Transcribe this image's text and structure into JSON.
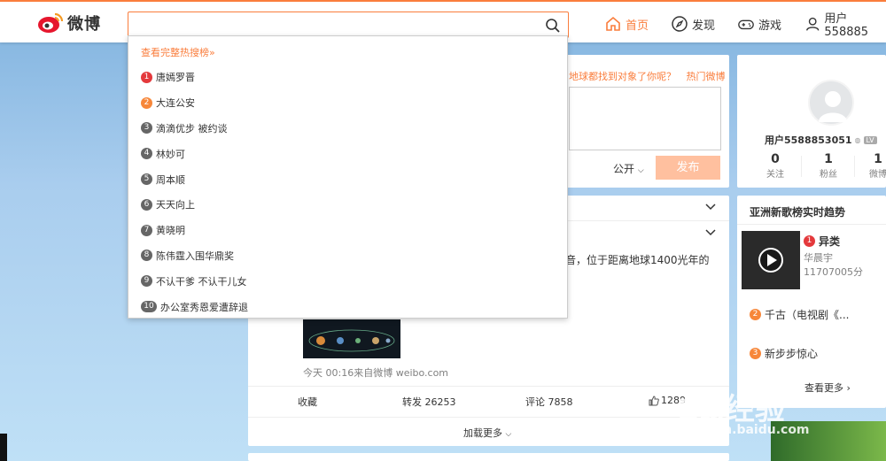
{
  "brand": {
    "name": "微博"
  },
  "search": {
    "value": "",
    "hot_link": "查看完整热搜榜»",
    "items": [
      "唐嫣罗晋",
      "大连公安",
      "滴滴优步 被约谈",
      "林妙可",
      "周本顺",
      "天天向上",
      "黄晓明",
      "陈伟霆入围华鼎奖",
      "不认干爹 不认干儿女",
      "办公室秀恩爱遭辞退"
    ]
  },
  "nav": {
    "home": "首页",
    "discover": "发现",
    "games": "游戏",
    "user": "用户558885"
  },
  "composer": {
    "prompt": "地球都找到对象了你呢？",
    "hot_weibo": "热门微博",
    "visibility": "公开",
    "publish": "发布"
  },
  "profile": {
    "name": "用户5588853051",
    "level": "LV",
    "following": "0",
    "following_label": "关注",
    "fans": "1",
    "fans_label": "粉丝",
    "posts": "1",
    "posts_label": "微博"
  },
  "feed": {
    "snippet": "音，位于距离地球1400光年的",
    "meta": "今天 00:16来自微博 weibo.com",
    "collect": "收藏",
    "repost": "转发 26253",
    "comment": "评论 7858",
    "like": "1289",
    "load_more": "加载更多"
  },
  "music": {
    "title": "亚洲新歌榜实时趋势",
    "s1_title": "异类",
    "s1_artist": "华晨宇",
    "s1_count": "11707005分",
    "s2_title": "千古（电视剧《...",
    "s3_title": "新步步惊心",
    "more": "查看更多"
  },
  "watermark": {
    "line1": "Bai经验",
    "line2": "jingyan.baidu.com"
  },
  "colors": {
    "accent": "#fa7d3c"
  }
}
